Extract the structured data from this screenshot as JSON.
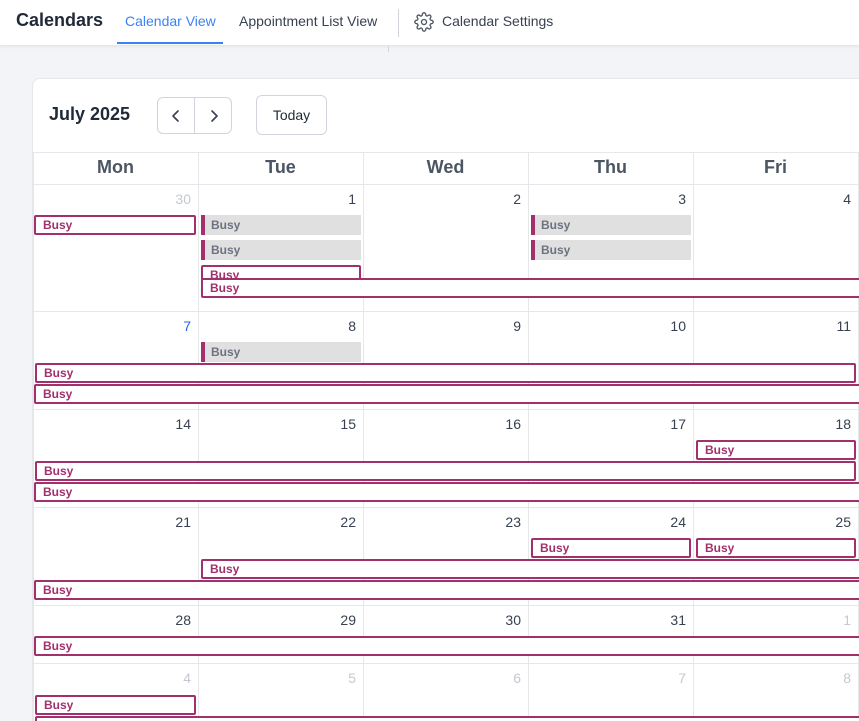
{
  "header": {
    "app_title": "Calendars",
    "tabs": [
      {
        "label": "Calendar View",
        "active": true
      },
      {
        "label": "Appointment List View",
        "active": false
      },
      {
        "label": "Calendar Settings",
        "active": false
      }
    ]
  },
  "toolbar": {
    "month_label": "July 2025",
    "prev_icon": "chevron-left-icon",
    "next_icon": "chevron-right-icon",
    "today_label": "Today"
  },
  "calendar": {
    "weekdays": [
      "Mon",
      "Tue",
      "Wed",
      "Thu",
      "Fri"
    ],
    "weeks": [
      [
        "30",
        "1",
        "2",
        "3",
        "4"
      ],
      [
        "7",
        "8",
        "9",
        "10",
        "11"
      ],
      [
        "14",
        "15",
        "16",
        "17",
        "18"
      ],
      [
        "21",
        "22",
        "23",
        "24",
        "25"
      ],
      [
        "28",
        "29",
        "30",
        "31",
        "1"
      ],
      [
        "4",
        "5",
        "6",
        "7",
        "8"
      ]
    ],
    "event_label": "Busy"
  },
  "colors": {
    "accent": "#3b82f6",
    "event": "#a1306c",
    "event_fill": "#e0e0e0",
    "today": "#2563eb"
  }
}
